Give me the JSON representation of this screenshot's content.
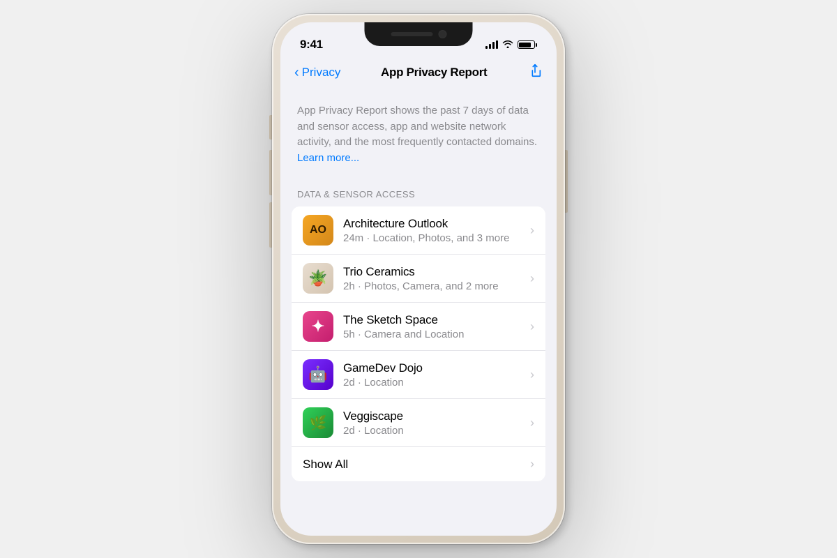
{
  "phone": {
    "status": {
      "time": "9:41"
    },
    "nav": {
      "back_label": "Privacy",
      "title": "App Privacy Report"
    },
    "info": {
      "text": "App Privacy Report shows the past 7 days of data and sensor access, app and website network activity, and the most frequently contacted domains.",
      "learn_more": "Learn more..."
    },
    "data_section": {
      "header": "DATA & SENSOR ACCESS"
    },
    "apps": [
      {
        "id": "architecture-outlook",
        "name": "Architecture Outlook",
        "detail": "24m · Location, Photos, and 3 more",
        "icon_text": "AO",
        "icon_style": "ao"
      },
      {
        "id": "trio-ceramics",
        "name": "Trio Ceramics",
        "detail": "2h · Photos, Camera, and 2 more",
        "icon_text": "🪴",
        "icon_style": "trio"
      },
      {
        "id": "sketch-space",
        "name": "The Sketch Space",
        "detail": "5h · Camera and Location",
        "icon_text": "✦",
        "icon_style": "sketch"
      },
      {
        "id": "gamedev-dojo",
        "name": "GameDev Dojo",
        "detail": "2d · Location",
        "icon_text": "🤖",
        "icon_style": "gamedev"
      },
      {
        "id": "veggiscape",
        "name": "Veggiscape",
        "detail": "2d · Location",
        "icon_text": "🌿",
        "icon_style": "veggi"
      }
    ],
    "show_all_label": "Show All"
  }
}
